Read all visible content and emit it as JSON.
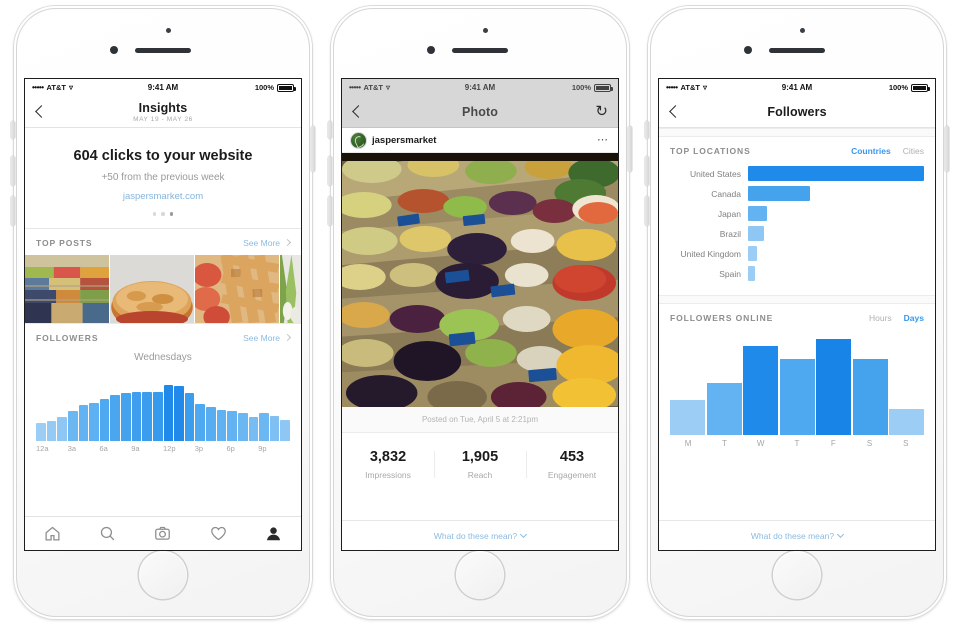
{
  "meta": {
    "accent_blue": "#3897f0",
    "link_blue": "#8bbbe3",
    "bar_blue_dark": "#1e88e5",
    "bar_blue_mid": "#42a5f5",
    "bar_blue_light": "#90caf9"
  },
  "status_bar": {
    "signal_dots": "•••••",
    "carrier": "AT&T",
    "wifi_icon": "wifi-icon",
    "time": "9:41 AM",
    "battery_pct": "100%"
  },
  "phone1": {
    "nav": {
      "back_icon": "chevron-left-icon",
      "title": "Insights",
      "subtitle": "MAY 19 - MAY 26"
    },
    "clicks_card": {
      "headline": "604 clicks to your website",
      "change": "+50 from the previous week",
      "link": "jaspersmarket.com",
      "page_dots": 3,
      "active_dot": 3
    },
    "top_posts": {
      "title": "TOP POSTS",
      "see_more": "See More",
      "thumbnails": [
        "market-produce-stalls",
        "apple-pie-whole",
        "lattice-pie-with-tomatoes",
        "spring-onions-partial"
      ]
    },
    "followers": {
      "title": "FOLLOWERS",
      "see_more": "See More",
      "chart_label": "Wednesdays"
    },
    "tab_bar": [
      {
        "name": "home-icon",
        "active": false
      },
      {
        "name": "search-icon",
        "active": false
      },
      {
        "name": "camera-icon",
        "active": false
      },
      {
        "name": "heart-icon",
        "active": false
      },
      {
        "name": "profile-icon",
        "active": true
      }
    ]
  },
  "phone2": {
    "nav": {
      "back_icon": "chevron-left-icon",
      "title": "Photo",
      "refresh_icon": "refresh-icon"
    },
    "post": {
      "username": "jaspersmarket",
      "avatar": "jaspers-market-logo",
      "more_icon": "more-options-icon",
      "image": "fruit-market-stall-photo",
      "posted_on": "Posted on Tue, April 5 at 2:21pm"
    },
    "stats": [
      {
        "value": "3,832",
        "label": "Impressions"
      },
      {
        "value": "1,905",
        "label": "Reach"
      },
      {
        "value": "453",
        "label": "Engagement"
      }
    ],
    "footer_link": "What do these mean?"
  },
  "phone3": {
    "nav": {
      "back_icon": "chevron-left-icon",
      "title": "Followers"
    },
    "top_locations": {
      "title": "TOP LOCATIONS",
      "toggle": [
        {
          "label": "Countries",
          "active": true
        },
        {
          "label": "Cities",
          "active": false
        }
      ]
    },
    "followers_online": {
      "title": "FOLLOWERS ONLINE",
      "toggle": [
        {
          "label": "Hours",
          "active": false
        },
        {
          "label": "Days",
          "active": true
        }
      ]
    },
    "footer_link": "What do these mean?"
  },
  "chart_data": [
    {
      "id": "followers-by-hour",
      "type": "bar",
      "title": "Wednesdays",
      "xlabel": "",
      "ylabel": "",
      "categories": [
        "12a",
        "1a",
        "2a",
        "3a",
        "4a",
        "5a",
        "6a",
        "7a",
        "8a",
        "9a",
        "10a",
        "11a",
        "12p",
        "1p",
        "2p",
        "3p",
        "4p",
        "5p",
        "6p",
        "7p",
        "8p",
        "9p",
        "10p",
        "11p"
      ],
      "tick_labels": [
        "12a",
        "3a",
        "6a",
        "9a",
        "12p",
        "3p",
        "6p",
        "9p"
      ],
      "values": [
        24,
        27,
        32,
        41,
        50,
        52,
        58,
        63,
        66,
        68,
        68,
        68,
        77,
        76,
        66,
        51,
        47,
        43,
        41,
        38,
        33,
        38,
        34,
        28
      ],
      "ylim": [
        0,
        100
      ],
      "grid": false,
      "legend": false,
      "colors": [
        "#9ccef5",
        "#95caf4",
        "#8ec7f4",
        "#6bb7f2",
        "#63b2f1",
        "#5db0f1",
        "#4ea9f0",
        "#49a6ef",
        "#45a3ee",
        "#3f9fee",
        "#3b9dee",
        "#369aed",
        "#1f8ae9",
        "#2189ea",
        "#3b9dee",
        "#4ea9f0",
        "#57adf0",
        "#5fb1f1",
        "#63b2f1",
        "#6bb7f2",
        "#77bcf3",
        "#6bb7f2",
        "#7ec0f3",
        "#8ec7f4"
      ]
    },
    {
      "id": "top-locations",
      "type": "bar",
      "orientation": "horizontal",
      "title": "TOP LOCATIONS",
      "xlabel": "",
      "ylabel": "",
      "categories": [
        "United States",
        "Canada",
        "Japan",
        "Brazil",
        "United Kingdom",
        "Spain"
      ],
      "values": [
        100,
        35,
        11,
        9,
        5,
        4
      ],
      "ylim": [
        0,
        100
      ],
      "grid": false,
      "legend": false,
      "colors": [
        "#1f8ae9",
        "#45a3ee",
        "#63b2f1",
        "#8ec7f4",
        "#9ccef5",
        "#9ccef5"
      ]
    },
    {
      "id": "followers-online-by-day",
      "type": "bar",
      "title": "FOLLOWERS ONLINE",
      "xlabel": "",
      "ylabel": "",
      "categories": [
        "M",
        "T",
        "W",
        "T",
        "F",
        "S",
        "S"
      ],
      "values": [
        33,
        50,
        85,
        72,
        91,
        72,
        25
      ],
      "ylim": [
        0,
        100
      ],
      "grid": false,
      "legend": false,
      "colors": [
        "#9ccef5",
        "#63b2f1",
        "#1f8ae9",
        "#4ea9f0",
        "#1884e8",
        "#45a3ee",
        "#9ccef5"
      ]
    }
  ]
}
